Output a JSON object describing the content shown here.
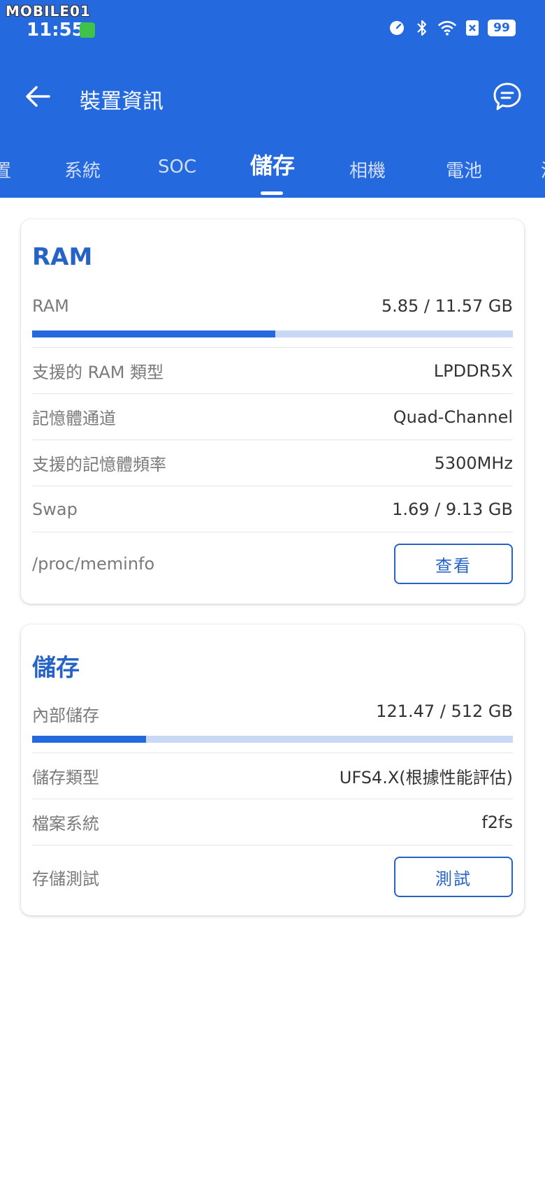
{
  "watermark": "MOBILE01",
  "status": {
    "time": "11:55",
    "battery": "99"
  },
  "appbar": {
    "title": "裝置資訊"
  },
  "tabs": [
    {
      "label": "置"
    },
    {
      "label": "系統"
    },
    {
      "label": "SOC"
    },
    {
      "label": "儲存"
    },
    {
      "label": "相機"
    },
    {
      "label": "電池"
    },
    {
      "label": "溫"
    }
  ],
  "ram_card": {
    "title": "RAM",
    "usage": {
      "label": "RAM",
      "value": "5.85 / 11.57 GB",
      "fraction": 0.5056
    },
    "rows": [
      {
        "label": "支援的 RAM 類型",
        "value": "LPDDR5X"
      },
      {
        "label": "記憶體通道",
        "value": "Quad-Channel"
      },
      {
        "label": "支援的記憶體頻率",
        "value": "5300MHz"
      },
      {
        "label": "Swap",
        "value": "1.69 / 9.13 GB"
      }
    ],
    "action": {
      "label": "/proc/meminfo",
      "button": "查看"
    }
  },
  "storage_card": {
    "title": "儲存",
    "usage": {
      "label": "內部儲存",
      "value": "121.47 / 512 GB",
      "fraction": 0.2372
    },
    "rows": [
      {
        "label": "儲存類型",
        "value": "UFS4.X(根據性能評估)"
      },
      {
        "label": "檔案系統",
        "value": "f2fs"
      }
    ],
    "action": {
      "label": "存儲測試",
      "button": "測試"
    }
  },
  "colors": {
    "primary": "#2469dd",
    "title": "#2563c7",
    "track": "#c9d8f4"
  }
}
